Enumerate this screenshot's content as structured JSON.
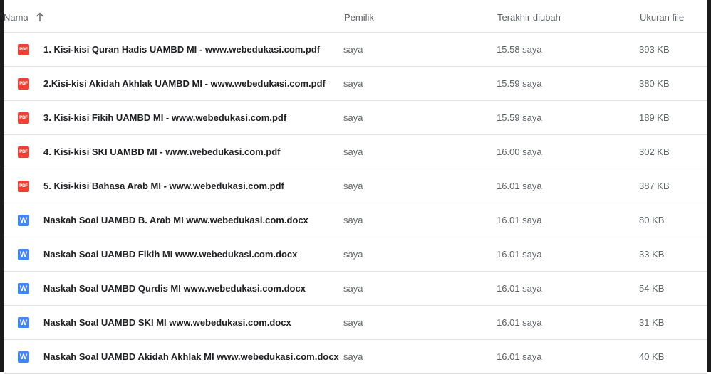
{
  "header": {
    "name": "Nama",
    "owner": "Pemilik",
    "modified": "Terakhir diubah",
    "size": "Ukuran file"
  },
  "files": [
    {
      "type": "pdf",
      "icon": "pdf-icon",
      "icon_text": "PDF",
      "name": "1. Kisi-kisi Quran Hadis UAMBD MI - www.webedukasi.com.pdf",
      "owner": "saya",
      "modified": "15.58 saya",
      "size": "393 KB"
    },
    {
      "type": "pdf",
      "icon": "pdf-icon",
      "icon_text": "PDF",
      "name": "2.Kisi-kisi Akidah Akhlak UAMBD MI - www.webedukasi.com.pdf",
      "owner": "saya",
      "modified": "15.59 saya",
      "size": "380 KB"
    },
    {
      "type": "pdf",
      "icon": "pdf-icon",
      "icon_text": "PDF",
      "name": "3. Kisi-kisi Fikih UAMBD MI - www.webedukasi.com.pdf",
      "owner": "saya",
      "modified": "15.59 saya",
      "size": "189 KB"
    },
    {
      "type": "pdf",
      "icon": "pdf-icon",
      "icon_text": "PDF",
      "name": "4. Kisi-kisi SKI UAMBD MI - www.webedukasi.com.pdf",
      "owner": "saya",
      "modified": "16.00 saya",
      "size": "302 KB"
    },
    {
      "type": "pdf",
      "icon": "pdf-icon",
      "icon_text": "PDF",
      "name": "5. Kisi-kisi Bahasa Arab MI - www.webedukasi.com.pdf",
      "owner": "saya",
      "modified": "16.01 saya",
      "size": "387 KB"
    },
    {
      "type": "docx",
      "icon": "word-icon",
      "icon_text": "W",
      "name": "Naskah Soal UAMBD B. Arab MI www.webedukasi.com.docx",
      "owner": "saya",
      "modified": "16.01 saya",
      "size": "80 KB"
    },
    {
      "type": "docx",
      "icon": "word-icon",
      "icon_text": "W",
      "name": "Naskah Soal UAMBD Fikih MI www.webedukasi.com.docx",
      "owner": "saya",
      "modified": "16.01 saya",
      "size": "33 KB"
    },
    {
      "type": "docx",
      "icon": "word-icon",
      "icon_text": "W",
      "name": "Naskah Soal UAMBD Qurdis MI www.webedukasi.com.docx",
      "owner": "saya",
      "modified": "16.01 saya",
      "size": "54 KB"
    },
    {
      "type": "docx",
      "icon": "word-icon",
      "icon_text": "W",
      "name": "Naskah Soal UAMBD SKI MI www.webedukasi.com.docx",
      "owner": "saya",
      "modified": "16.01 saya",
      "size": "31 KB"
    },
    {
      "type": "docx",
      "icon": "word-icon",
      "icon_text": "W",
      "name": "Naskah Soal UAMBD Akidah Akhlak MI www.webedukasi.com.docx",
      "owner": "saya",
      "modified": "16.01 saya",
      "size": "40 KB"
    }
  ]
}
